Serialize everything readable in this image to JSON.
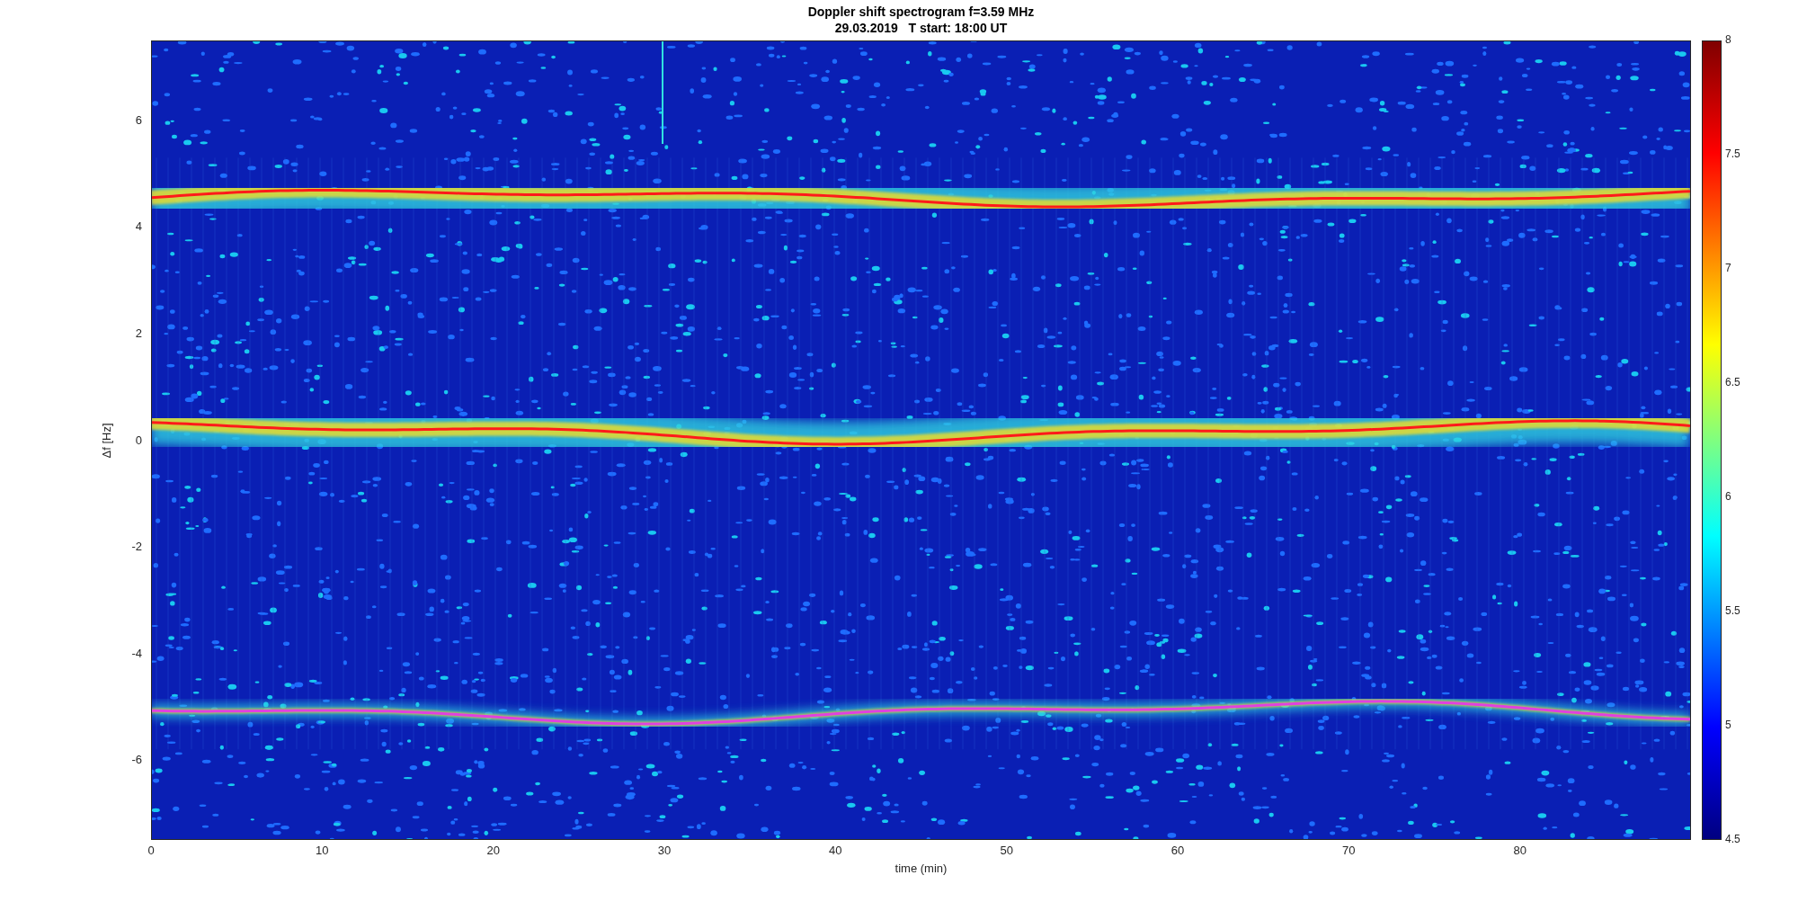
{
  "figure": {
    "title": "Doppler shift spectrogram f=3.59 MHz",
    "subtitle": "29.03.2019   T start: 18:00 UT",
    "plot": {
      "xlabel": "time (min)",
      "ylabel": "Δf [Hz]",
      "xticks": [
        "0",
        "10",
        "20",
        "30",
        "40",
        "50",
        "60",
        "70",
        "80"
      ],
      "yticks": [
        "6",
        "4",
        "2",
        "0",
        "-2",
        "-4",
        "-6"
      ],
      "colorbar_ticks": [
        "8",
        "7.5",
        "7",
        "6.5",
        "6",
        "5.5",
        "5",
        "4.5"
      ]
    }
  }
}
